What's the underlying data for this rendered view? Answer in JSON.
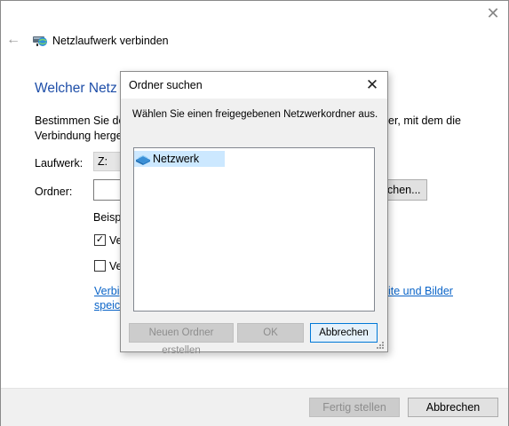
{
  "wizard": {
    "title": "Netzlaufwerk verbinden",
    "heading": "Welcher Netz",
    "description_line1": "Bestimmen Sie de",
    "description_line2": "Verbindung herge",
    "description_right": "er, mit dem die",
    "drive_label": "Laufwerk:",
    "drive_value": "Z:",
    "folder_label": "Ordner:",
    "folder_value": "",
    "browse_label": "chen...",
    "example_label": "Beisp",
    "checkbox1": {
      "label": "Ve",
      "checked": true
    },
    "checkbox2": {
      "label": "Ve",
      "checked": false
    },
    "link_line1": "Verbi",
    "link_line2": "speic",
    "link_right": "ite und Bilder",
    "finish_label": "Fertig stellen",
    "cancel_label": "Abbrechen"
  },
  "dialog": {
    "title": "Ordner suchen",
    "message": "Wählen Sie einen freigegebenen Netzwerkordner aus.",
    "tree": [
      {
        "label": "Netzwerk",
        "icon": "network-icon",
        "selected": true
      }
    ],
    "new_folder_label": "Neuen Ordner erstellen",
    "ok_label": "OK",
    "cancel_label": "Abbrechen"
  },
  "icons": {
    "back": "back-arrow-icon",
    "close": "close-icon",
    "network_drive": "network-drive-icon"
  },
  "colors": {
    "heading": "#1e4ea8",
    "link": "#0a64c8",
    "selection": "#cce8ff",
    "focus_border": "#0078d7"
  }
}
